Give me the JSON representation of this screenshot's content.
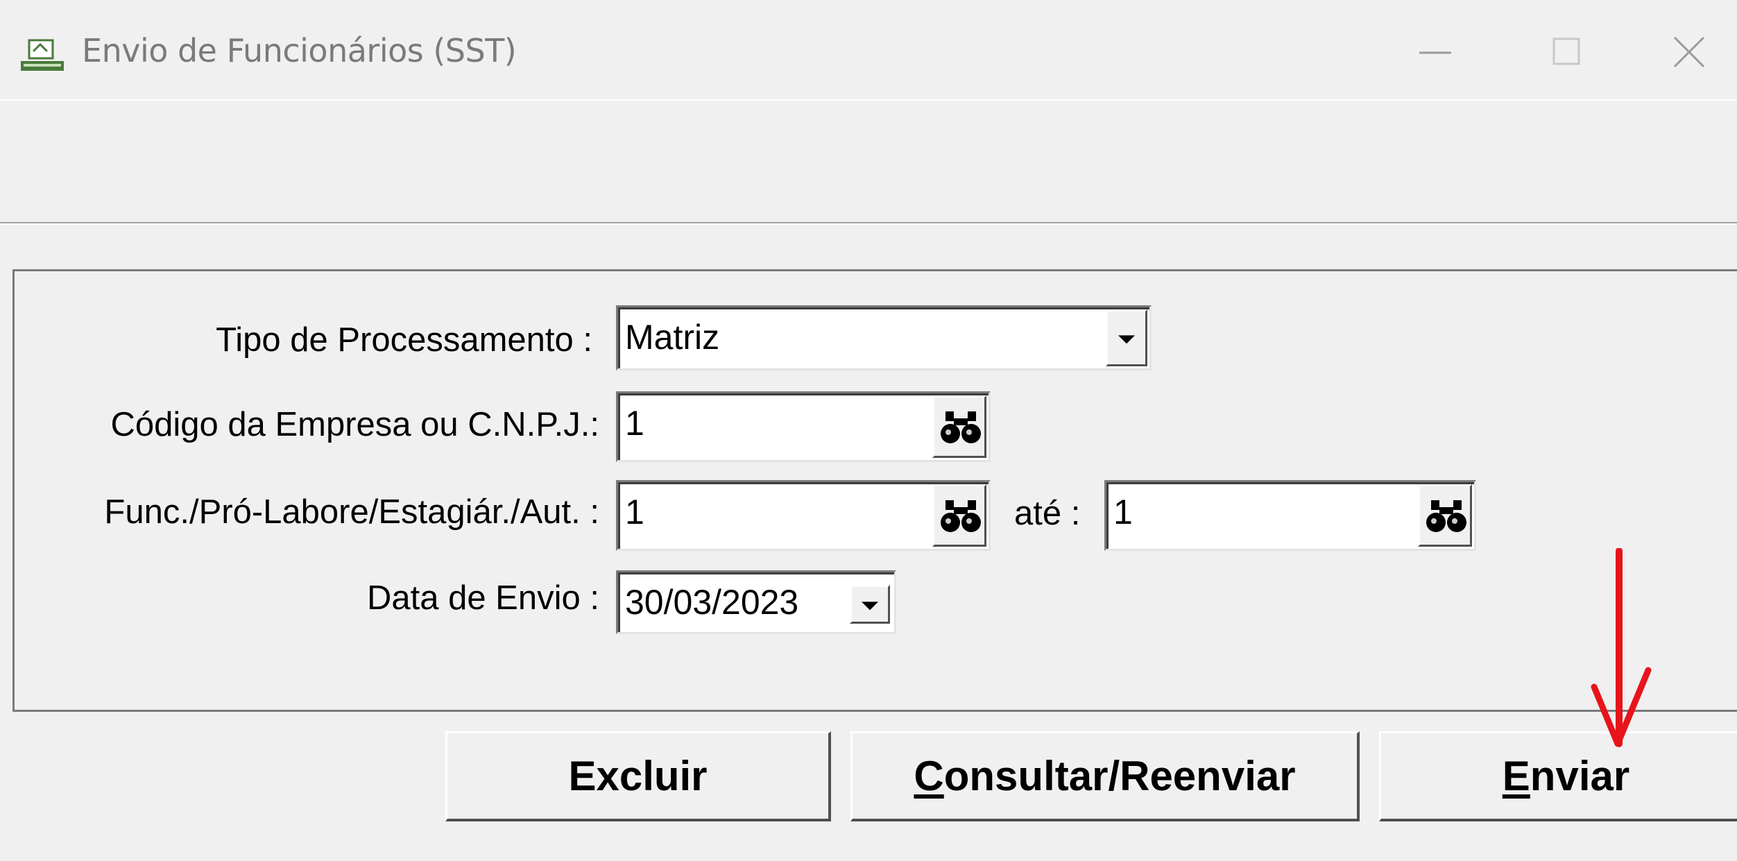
{
  "window": {
    "title": "Envio de Funcionários (SST)",
    "icon": "efiscal-app-icon",
    "controls": [
      "minimize-icon",
      "maximize-icon",
      "close-icon"
    ]
  },
  "form": {
    "tipo_label": "Tipo de Processamento :",
    "tipo_value": "Matriz",
    "empresa_label": "Código da Empresa ou C.N.P.J.:",
    "empresa_value": "1",
    "func_label": "Func./Pró-Labore/Estagiár./Aut. :",
    "func_value": "1",
    "ate_label": "até :",
    "ate_value": "1",
    "data_label": "Data de Envio :",
    "data_value": "30/03/2023"
  },
  "buttons": {
    "excluir": "Excluir",
    "consultar_first": "C",
    "consultar_rest": "onsultar/Reenviar",
    "enviar_first": "E",
    "enviar_rest": "nviar"
  },
  "annotation": {
    "icon": "red-arrow-down-icon",
    "color": "#e8141b"
  }
}
